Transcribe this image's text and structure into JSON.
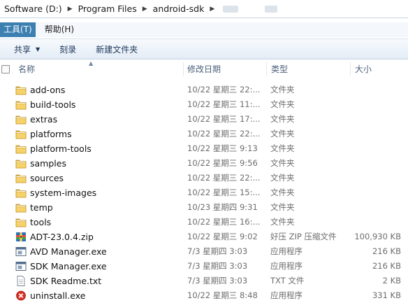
{
  "address": {
    "crumbs": [
      "Software (D:)",
      "Program Files",
      "android-sdk"
    ]
  },
  "menu": {
    "items": [
      "工具(T)",
      "帮助(H)"
    ]
  },
  "toolbar": {
    "share_label": "共享",
    "burn_label": "刻录",
    "new_folder_label": "新建文件夹"
  },
  "columns": {
    "name": "名称",
    "modified": "修改日期",
    "type": "类型",
    "size": "大小"
  },
  "files": [
    {
      "name": "add-ons",
      "modified": "10/22 星期三 22:...",
      "type": "文件夹",
      "size": "",
      "icon": "folder-icon"
    },
    {
      "name": "build-tools",
      "modified": "10/22 星期三 11:...",
      "type": "文件夹",
      "size": "",
      "icon": "folder-icon"
    },
    {
      "name": "extras",
      "modified": "10/22 星期三 17:...",
      "type": "文件夹",
      "size": "",
      "icon": "folder-icon"
    },
    {
      "name": "platforms",
      "modified": "10/22 星期三 22:...",
      "type": "文件夹",
      "size": "",
      "icon": "folder-icon"
    },
    {
      "name": "platform-tools",
      "modified": "10/22 星期三 9:13",
      "type": "文件夹",
      "size": "",
      "icon": "folder-icon"
    },
    {
      "name": "samples",
      "modified": "10/22 星期三 9:56",
      "type": "文件夹",
      "size": "",
      "icon": "folder-icon"
    },
    {
      "name": "sources",
      "modified": "10/22 星期三 22:...",
      "type": "文件夹",
      "size": "",
      "icon": "folder-icon"
    },
    {
      "name": "system-images",
      "modified": "10/22 星期三 15:...",
      "type": "文件夹",
      "size": "",
      "icon": "folder-icon"
    },
    {
      "name": "temp",
      "modified": "10/23 星期四 9:31",
      "type": "文件夹",
      "size": "",
      "icon": "folder-icon"
    },
    {
      "name": "tools",
      "modified": "10/22 星期三 16:...",
      "type": "文件夹",
      "size": "",
      "icon": "folder-icon"
    },
    {
      "name": "ADT-23.0.4.zip",
      "modified": "10/22 星期三 9:02",
      "type": "好压 ZIP 压缩文件",
      "size": "100,930 KB",
      "icon": "zip-archive-icon"
    },
    {
      "name": "AVD Manager.exe",
      "modified": "7/3 星期四 3:03",
      "type": "应用程序",
      "size": "216 KB",
      "icon": "application-icon"
    },
    {
      "name": "SDK Manager.exe",
      "modified": "7/3 星期四 3:03",
      "type": "应用程序",
      "size": "216 KB",
      "icon": "application-icon"
    },
    {
      "name": "SDK Readme.txt",
      "modified": "7/3 星期四 3:03",
      "type": "TXT 文件",
      "size": "2 KB",
      "icon": "text-file-icon"
    },
    {
      "name": "uninstall.exe",
      "modified": "10/22 星期三 8:48",
      "type": "应用程序",
      "size": "331 KB",
      "icon": "uninstall-icon"
    }
  ]
}
